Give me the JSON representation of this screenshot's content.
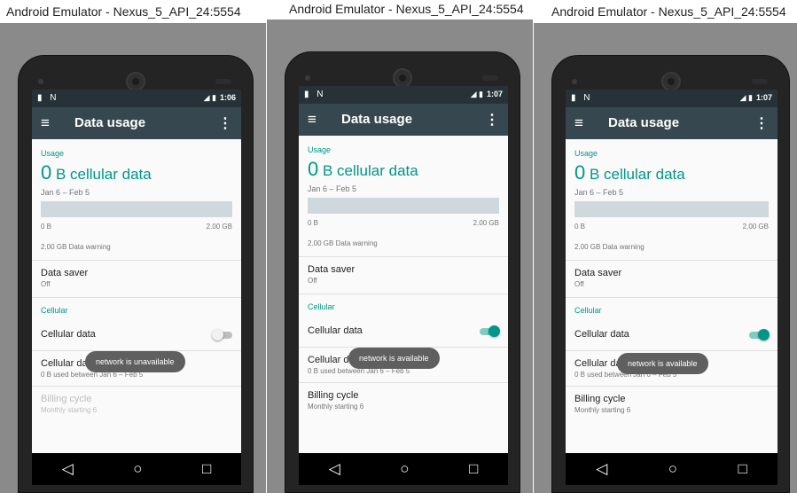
{
  "panels": [
    {
      "window_title": "Android Emulator - Nexus_5_API_24:5554",
      "status": {
        "left_icons": "▮ N",
        "right_icons": "◢ ▮",
        "time": "1:06"
      },
      "toolbar": {
        "title": "Data usage",
        "menu_icon": "≡",
        "overflow_icon": "⋮"
      },
      "usage": {
        "header": "Usage",
        "amount_num": "0",
        "amount_text": "B cellular data",
        "range": "Jan 6 – Feb 5",
        "bar_min": "0 B",
        "bar_max": "2.00 GB",
        "warning": "2.00 GB Data warning"
      },
      "data_saver": {
        "label": "Data saver",
        "value": "Off"
      },
      "cellular": {
        "header": "Cellular",
        "cellular_data_label": "Cellular data",
        "toggle_state": "off",
        "usage_label": "Cellular data usage",
        "usage_value": "0 B used between Jan 6 – Feb 5",
        "billing_label": "Billing cycle",
        "billing_value": "Monthly starting 6"
      },
      "toast": "network is unavailable"
    },
    {
      "window_title": "Android Emulator - Nexus_5_API_24:5554",
      "status": {
        "left_icons": "▮ N",
        "right_icons": "◢ ▮",
        "time": "1:07"
      },
      "toolbar": {
        "title": "Data usage",
        "menu_icon": "≡",
        "overflow_icon": "⋮"
      },
      "usage": {
        "header": "Usage",
        "amount_num": "0",
        "amount_text": "B cellular data",
        "range": "Jan 6 – Feb 5",
        "bar_min": "0 B",
        "bar_max": "2.00 GB",
        "warning": "2.00 GB Data warning"
      },
      "data_saver": {
        "label": "Data saver",
        "value": "Off"
      },
      "cellular": {
        "header": "Cellular",
        "cellular_data_label": "Cellular data",
        "toggle_state": "on",
        "usage_label": "Cellular data usage",
        "usage_value": "0 B used between Jan 6 – Feb 5",
        "billing_label": "Billing cycle",
        "billing_value": "Monthly starting 6"
      },
      "toast": "network is available"
    },
    {
      "window_title": "Android Emulator - Nexus_5_API_24:5554",
      "status": {
        "left_icons": "▮ N",
        "right_icons": "◢ ▮",
        "time": "1:07"
      },
      "toolbar": {
        "title": "Data usage",
        "menu_icon": "≡",
        "overflow_icon": "⋮"
      },
      "usage": {
        "header": "Usage",
        "amount_num": "0",
        "amount_text": "B cellular data",
        "range": "Jan 6 – Feb 5",
        "bar_min": "0 B",
        "bar_max": "2.00 GB",
        "warning": "2.00 GB Data warning"
      },
      "data_saver": {
        "label": "Data saver",
        "value": "Off"
      },
      "cellular": {
        "header": "Cellular",
        "cellular_data_label": "Cellular data",
        "toggle_state": "on",
        "usage_label": "Cellular data usage",
        "usage_value": "0 B used between Jan 6 – Feb 5",
        "billing_label": "Billing cycle",
        "billing_value": "Monthly starting 6"
      },
      "toast": "network is available"
    }
  ],
  "navbar": {
    "back_icon": "◁",
    "home_icon": "○",
    "recents_icon": "□"
  },
  "colors": {
    "accent": "#009688",
    "toolbar": "#37474f",
    "statusbar": "#263238",
    "toast": "#5f5f5f"
  }
}
